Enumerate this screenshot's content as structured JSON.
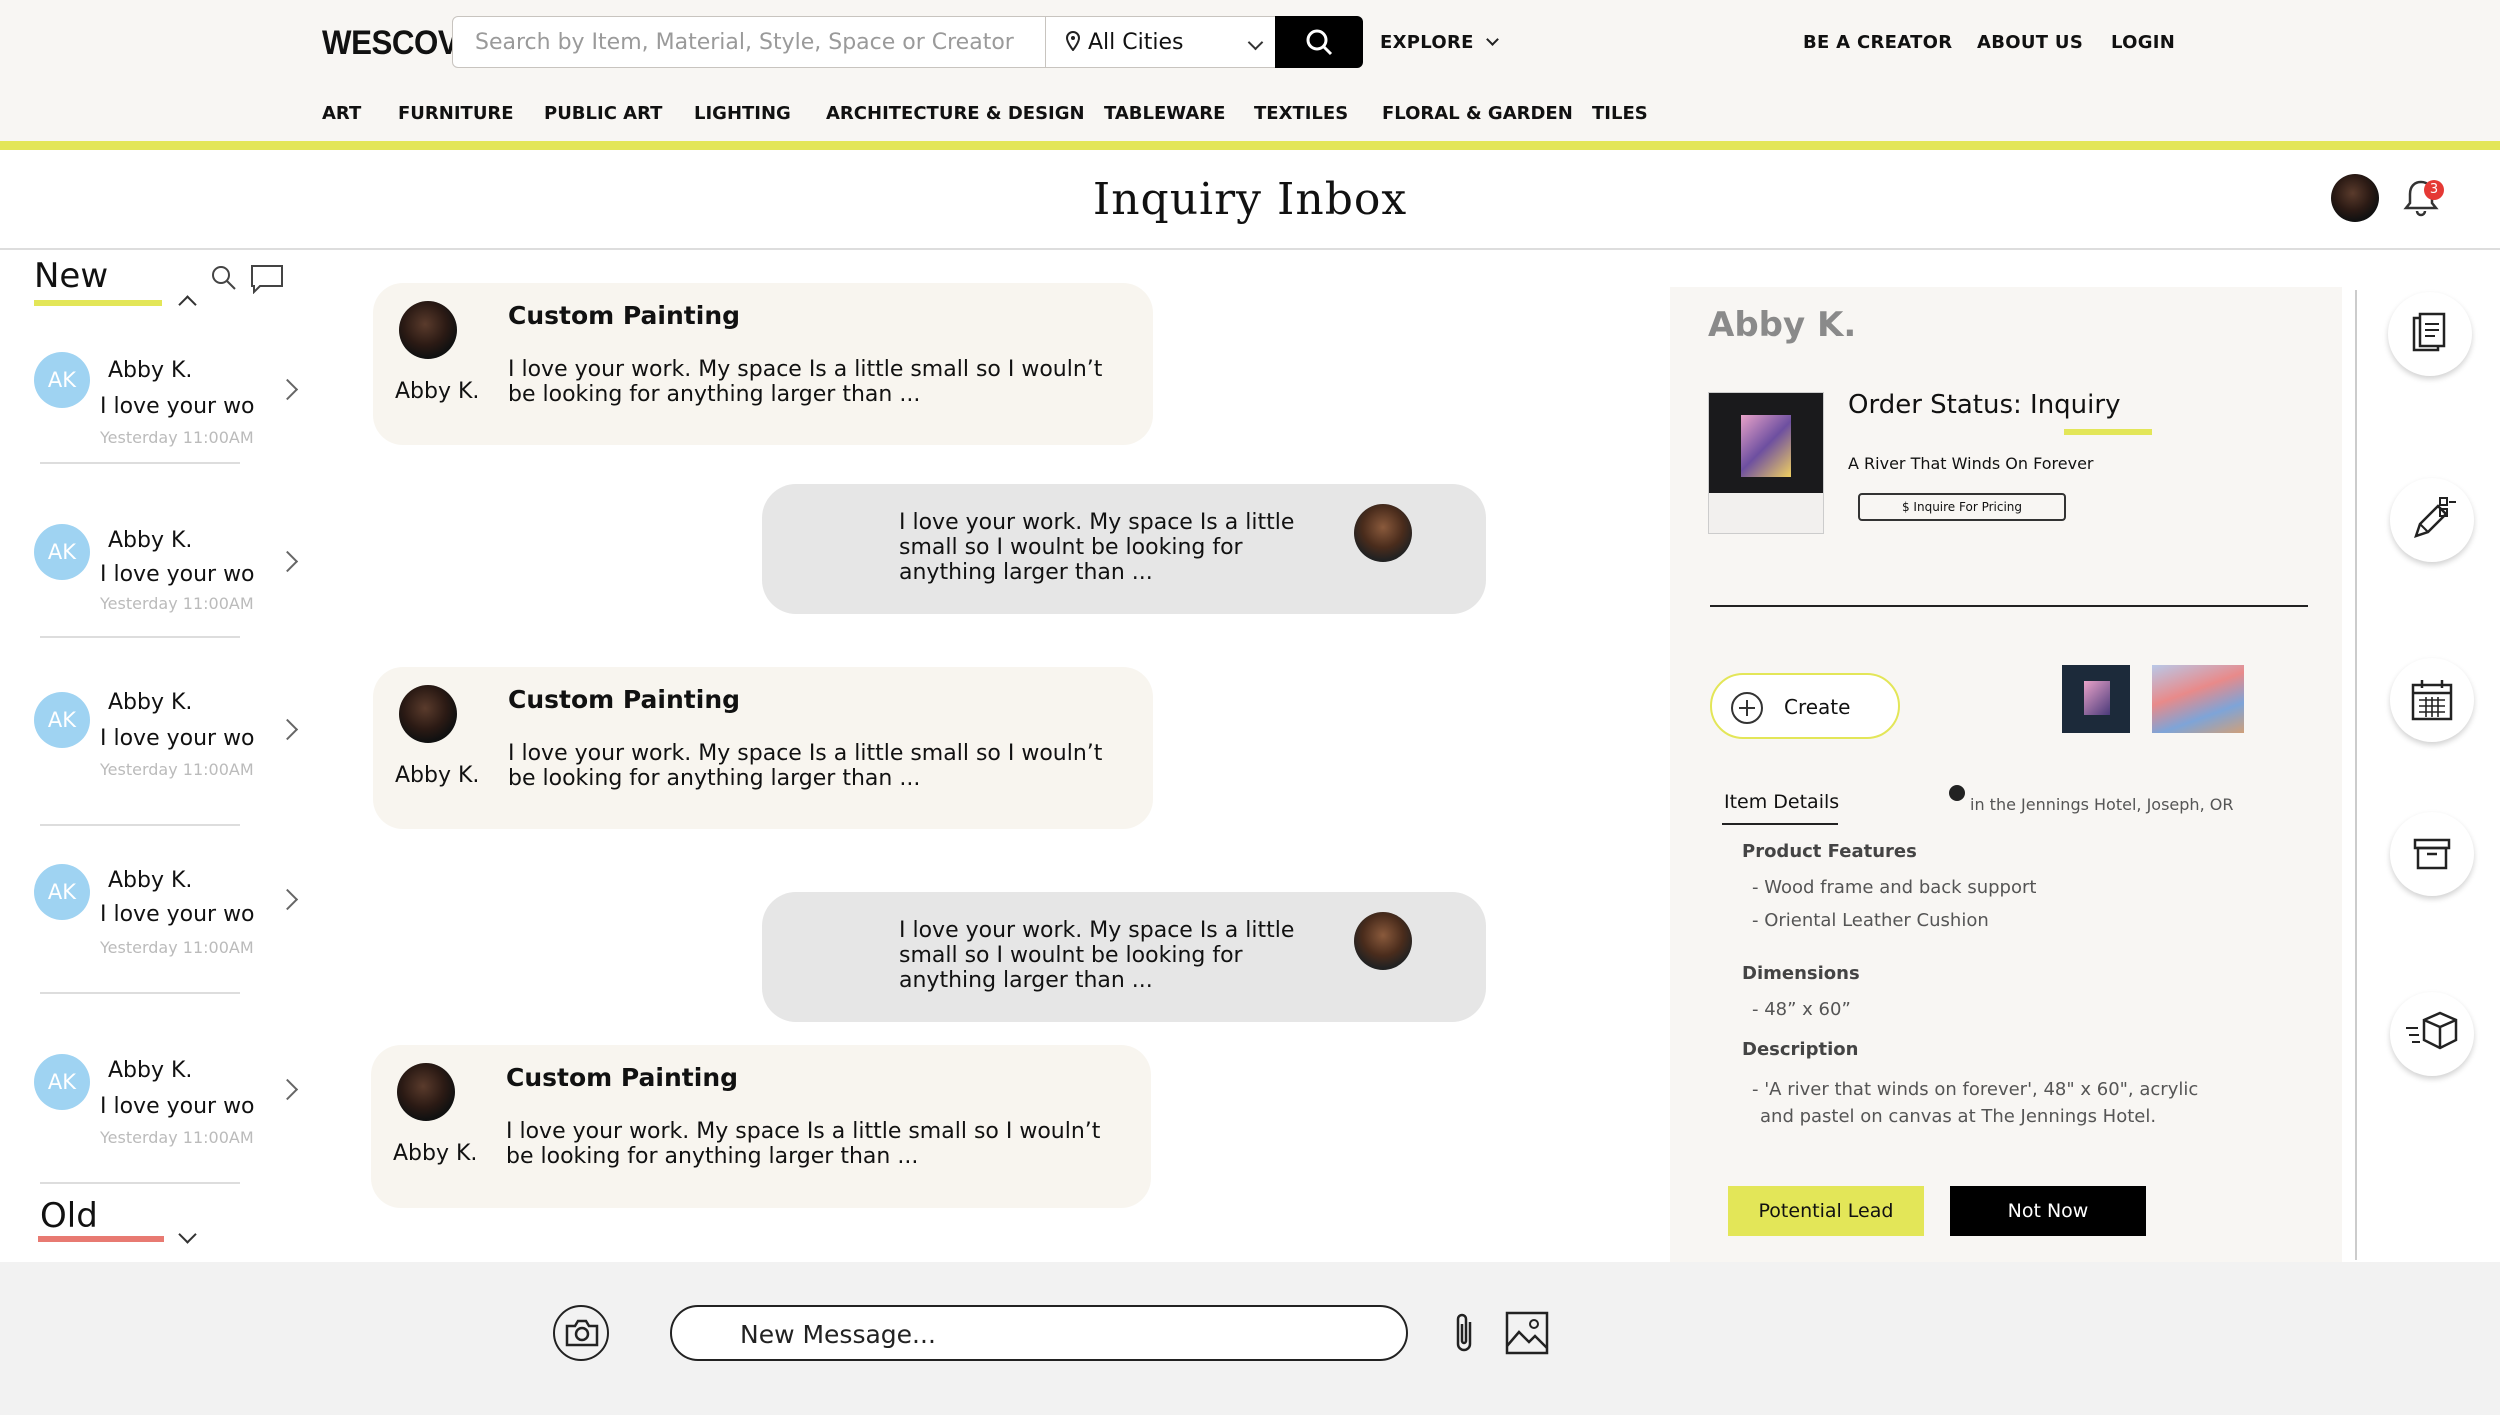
{
  "header": {
    "logo": "WESCOVER",
    "search_placeholder": "Search by Item, Material, Style, Space or Creator",
    "city": "All Cities",
    "explore": "EXPLORE",
    "links": [
      "BE A CREATOR",
      "ABOUT US",
      "LOGIN"
    ],
    "categories": [
      "ART",
      "FURNITURE",
      "PUBLIC ART",
      "LIGHTING",
      "ARCHITECTURE & DESIGN",
      "TABLEWARE",
      "TEXTILES",
      "FLORAL & GARDEN",
      "TILES"
    ],
    "accent_color": "#e3e658"
  },
  "page": {
    "title": "Inquiry Inbox",
    "notification_count": "3"
  },
  "sidebar": {
    "new_label": "New",
    "old_label": "Old",
    "items": [
      {
        "initials": "AK",
        "name": "Abby K.",
        "preview": "I love your wo",
        "time": "Yesterday 11:00AM"
      },
      {
        "initials": "AK",
        "name": "Abby K.",
        "preview": "I love your wo",
        "time": "Yesterday 11:00AM"
      },
      {
        "initials": "AK",
        "name": "Abby K.",
        "preview": "I love your wo",
        "time": "Yesterday 11:00AM"
      },
      {
        "initials": "AK",
        "name": "Abby K.",
        "preview": "I love your wo",
        "time": "Yesterday 11:00AM"
      },
      {
        "initials": "AK",
        "name": "Abby K.",
        "preview": "I love your wo",
        "time": "Yesterday 11:00AM"
      }
    ]
  },
  "messages": {
    "incoming_title": "Custom Painting",
    "incoming_sender": "Abby K.",
    "incoming_body": "I love your work. My space Is a little small so I wouln’t be looking for anything larger than ...",
    "outgoing_body": "I love your work. My space Is a little small so I woulnt be looking for anything larger than ..."
  },
  "detail": {
    "name": "Abby K.",
    "order_status_label": "Order Status: ",
    "order_status_value": "Inquiry",
    "artwork_title": "A River That Winds On Forever",
    "pricing_button": "$ Inquire For Pricing",
    "create_label": "Create",
    "tab_item_details": "Item Details",
    "location": "in the Jennings Hotel, Joseph, OR",
    "features_heading": "Product Features",
    "features": [
      "- Wood frame and back support",
      "- Oriental Leather Cushion"
    ],
    "dimensions_heading": "Dimensions",
    "dimensions": "- 48” x 60”",
    "description_heading": "Description",
    "description_line1": "- 'A river that winds on forever', 48\" x 60\", acrylic",
    "description_line2": "and pastel on canvas at The Jennings Hotel.",
    "lead_button": "Potential Lead",
    "not_now_button": "Not Now"
  },
  "composer": {
    "placeholder": "New Message..."
  }
}
